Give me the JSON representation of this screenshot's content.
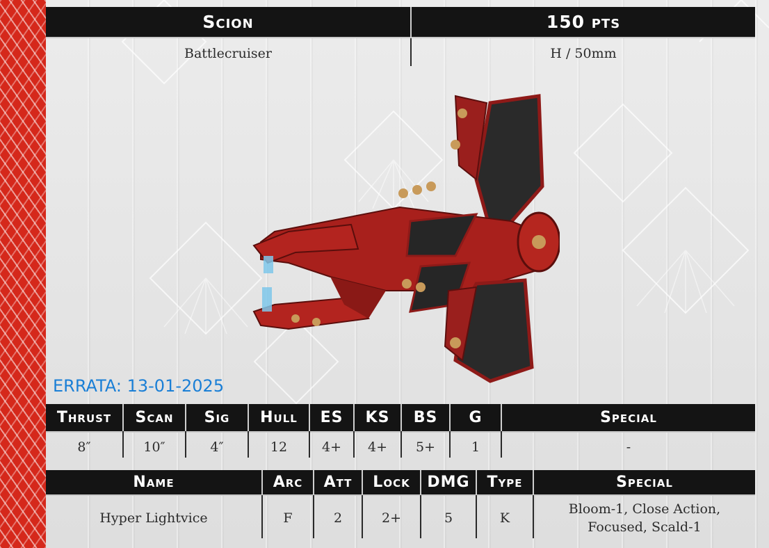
{
  "title": {
    "name": "Scion",
    "points": "150 pts"
  },
  "subtitle": {
    "class": "Battlecruiser",
    "base": "H / 50mm"
  },
  "errata": "ERRATA: 13-01-2025",
  "stats": {
    "headers": [
      "Thrust",
      "Scan",
      "Sig",
      "Hull",
      "ES",
      "KS",
      "BS",
      "G",
      "Special"
    ],
    "values": [
      "8″",
      "10″",
      "4″",
      "12",
      "4+",
      "4+",
      "5+",
      "1",
      "-"
    ]
  },
  "weapons": {
    "headers": [
      "Name",
      "Arc",
      "Att",
      "Lock",
      "DMG",
      "Type",
      "Special"
    ],
    "rows": [
      {
        "name": "Hyper Lightvice",
        "arc": "F",
        "att": "2",
        "lock": "2+",
        "dmg": "5",
        "type": "K",
        "special_line1": "Bloom-1, Close Action,",
        "special_line2": "Focused, Scald-1"
      }
    ]
  },
  "colors": {
    "accent": "#d5281b",
    "header_bg": "#141414",
    "errata": "#1a7fd6"
  }
}
